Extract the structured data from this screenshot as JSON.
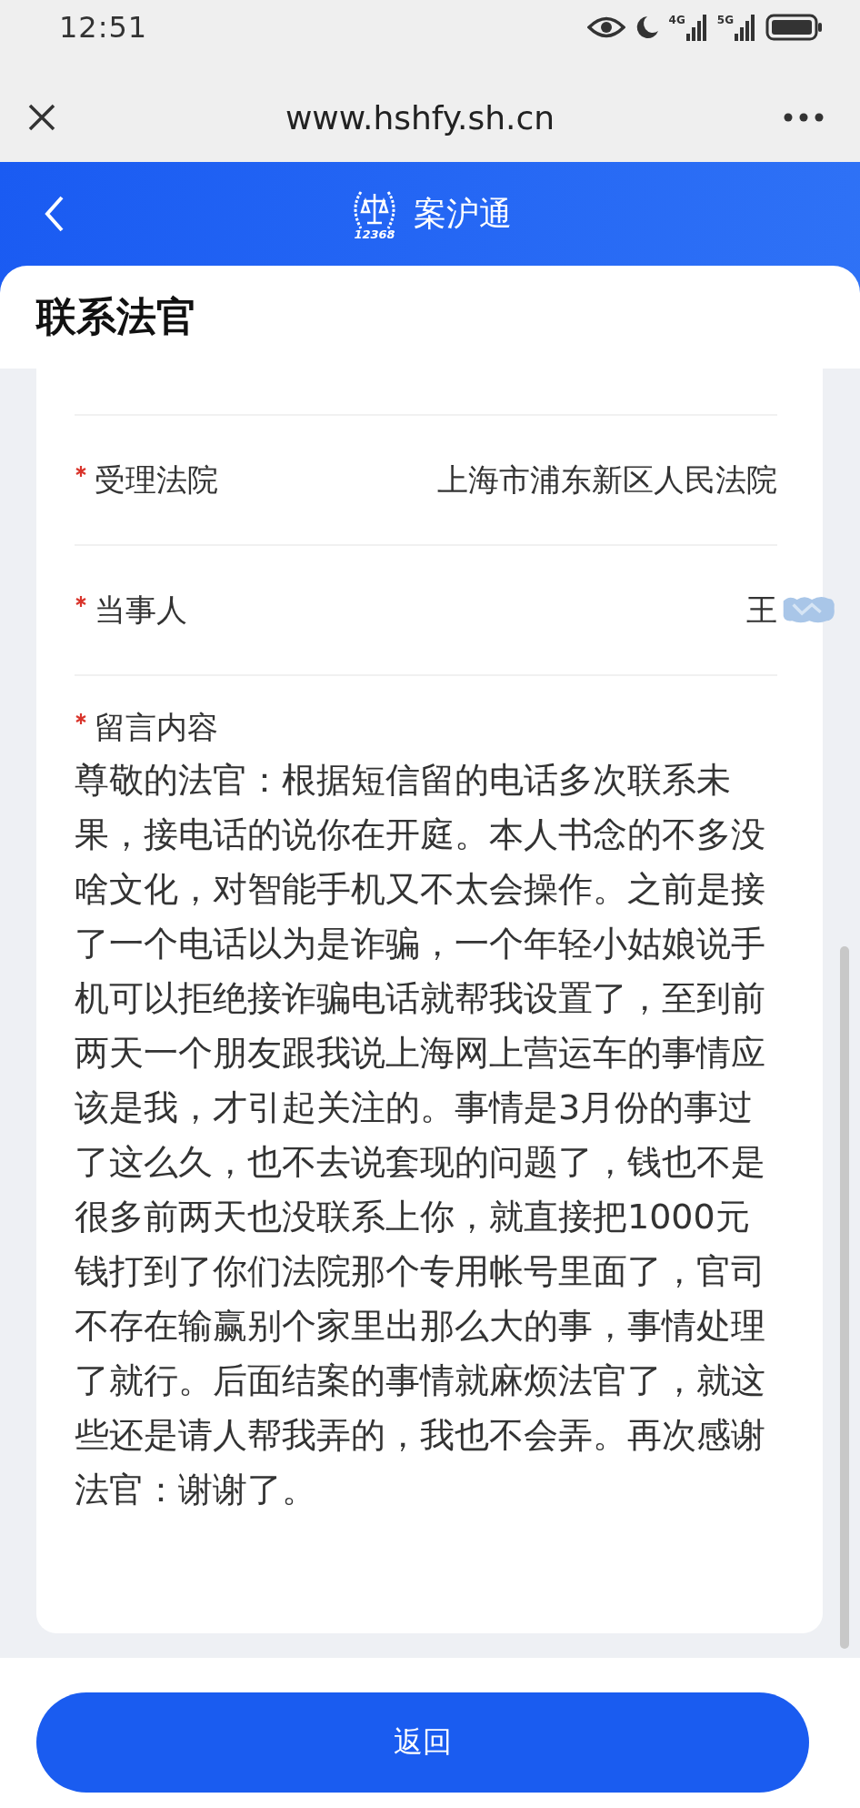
{
  "status_bar": {
    "time": "12:51",
    "network_labels": [
      "4G",
      "5G"
    ]
  },
  "browser": {
    "url": "www.hshfy.sh.cn"
  },
  "app_header": {
    "logo_text": "12368",
    "title": "案沪通"
  },
  "page_title": "联系法官",
  "fields": [
    {
      "label": "受理法院",
      "required": true,
      "value": "上海市浦东新区人民法院",
      "redacted": false
    },
    {
      "label": "当事人",
      "required": true,
      "value": "王",
      "redacted": true
    }
  ],
  "message": {
    "label": "留言内容",
    "required": true,
    "text": "尊敬的法官：根据短信留的电话多次联系未果，接电话的说你在开庭。本人书念的不多没啥文化，对智能手机又不太会操作。之前是接了一个电话以为是诈骗，一个年轻小姑娘说手机可以拒绝接诈骗电话就帮我设置了，至到前两天一个朋友跟我说上海网上营运车的事情应该是我，才引起关注的。事情是3月份的事过了这么久，也不去说套现的问题了，钱也不是很多前两天也没联系上你，就直接把1000元钱打到了你们法院那个专用帐号里面了，官司不存在输赢别个家里出那么大的事，事情处理了就行。后面结案的事情就麻烦法官了，就这些还是请人帮我弄的，我也不会弄。再次感谢法官：谢谢了。"
  },
  "buttons": [
    "返回"
  ]
}
